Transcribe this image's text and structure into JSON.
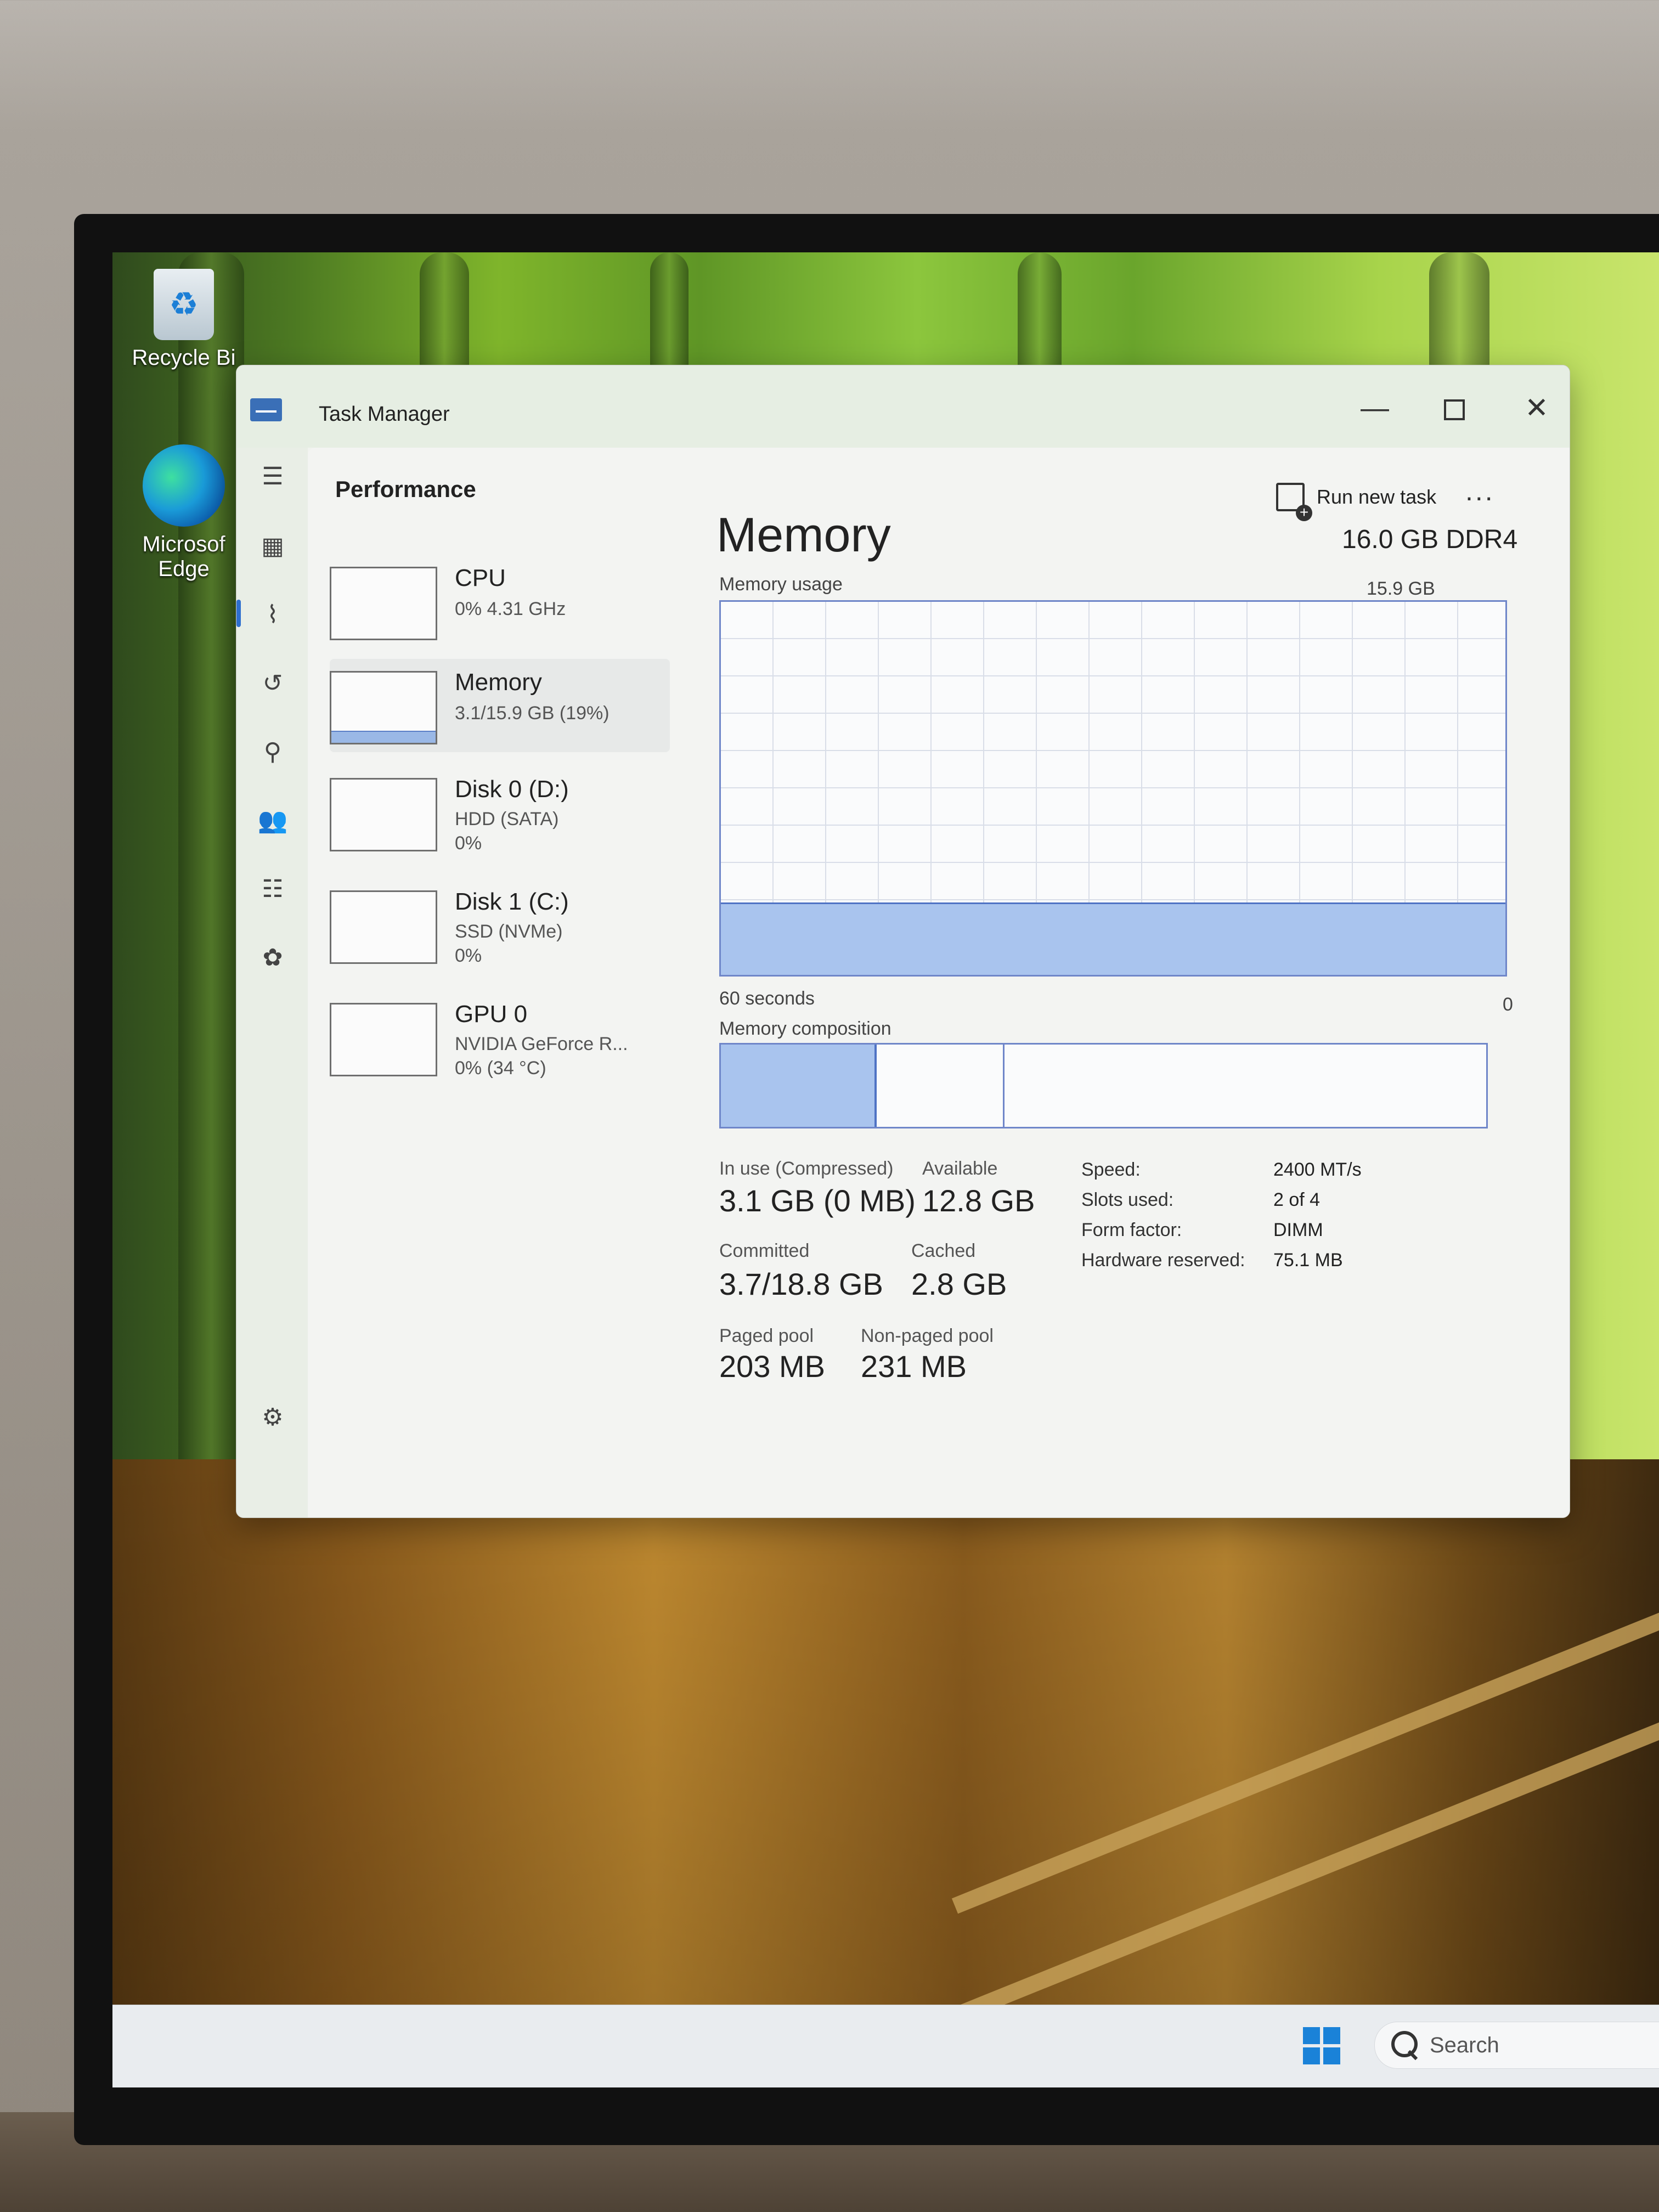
{
  "desktop": {
    "icons": [
      {
        "label": "Recycle Bi",
        "icon": "recycle-bin-icon"
      },
      {
        "label": "Microsof Edge",
        "icon": "edge-icon"
      }
    ]
  },
  "taskbar": {
    "search_placeholder": "Search",
    "start_icon": "windows-logo-icon"
  },
  "window": {
    "title": "Task Manager",
    "controls": {
      "minimize": "—",
      "close": "✕"
    }
  },
  "nav": {
    "icons": [
      "hamburger-icon",
      "processes-icon",
      "performance-icon",
      "app-history-icon",
      "startup-apps-icon",
      "users-icon",
      "details-icon",
      "services-icon",
      "settings-icon"
    ],
    "active": "performance"
  },
  "toolbar": {
    "page_title": "Performance",
    "run_new_task": "Run new task",
    "more": "..."
  },
  "devices": [
    {
      "name": "CPU",
      "line1": "0% 4.31 GHz",
      "line2": ""
    },
    {
      "name": "Memory",
      "line1": "3.1/15.9 GB (19%)",
      "line2": "",
      "selected": true
    },
    {
      "name": "Disk 0 (D:)",
      "line1": "HDD (SATA)",
      "line2": "0%"
    },
    {
      "name": "Disk 1 (C:)",
      "line1": "SSD (NVMe)",
      "line2": "0%"
    },
    {
      "name": "GPU 0",
      "line1": "NVIDIA GeForce R...",
      "line2": "0% (34 °C)"
    }
  ],
  "memory": {
    "title": "Memory",
    "type": "16.0 GB DDR4",
    "usage_label": "Memory usage",
    "usage_max": "15.9 GB",
    "time_span": "60 seconds",
    "time_end": "0",
    "usage_fraction": 0.19,
    "composition_label": "Memory composition",
    "stats": {
      "in_use_label": "In use (Compressed)",
      "in_use": "3.1 GB (0 MB)",
      "available_label": "Available",
      "available": "12.8 GB",
      "committed_label": "Committed",
      "committed": "3.7/18.8 GB",
      "cached_label": "Cached",
      "cached": "2.8 GB",
      "paged_label": "Paged pool",
      "paged": "203 MB",
      "nonpaged_label": "Non-paged pool",
      "nonpaged": "231 MB"
    },
    "specs": [
      {
        "key": "Speed:",
        "value": "2400 MT/s"
      },
      {
        "key": "Slots used:",
        "value": "2 of 4"
      },
      {
        "key": "Form factor:",
        "value": "DIMM"
      },
      {
        "key": "Hardware reserved:",
        "value": "75.1 MB"
      }
    ]
  }
}
